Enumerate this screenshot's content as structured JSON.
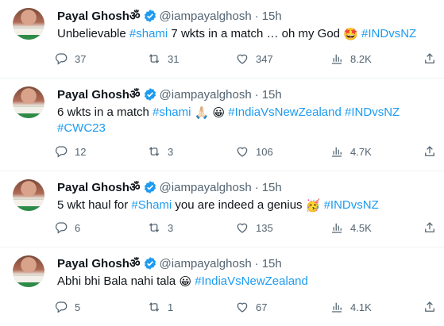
{
  "tweets": [
    {
      "name": "Payal Ghoshॐ",
      "handle": "@iampayalghosh",
      "dot": "·",
      "time": "15h",
      "text_parts": [
        "Unbelievable ",
        "#shami",
        " 7 wkts in a match … oh my God ",
        "🤩",
        " ",
        "#INDvsNZ"
      ],
      "replies": "37",
      "retweets": "31",
      "likes": "347",
      "views": "8.2K"
    },
    {
      "name": "Payal Ghoshॐ",
      "handle": "@iampayalghosh",
      "dot": "·",
      "time": "15h",
      "text_parts": [
        "6 wkts in a match  ",
        "#shami",
        " ",
        "🙏🏻",
        " ",
        "😀",
        " ",
        "#IndiaVsNewZealand",
        " ",
        "#INDvsNZ",
        " ",
        "#CWC23"
      ],
      "replies": "12",
      "retweets": "3",
      "likes": "106",
      "views": "4.7K"
    },
    {
      "name": "Payal Ghoshॐ",
      "handle": "@iampayalghosh",
      "dot": "·",
      "time": "15h",
      "text_parts": [
        "5 wkt haul for ",
        "#Shami",
        " you are indeed a genius ",
        "🥳",
        " ",
        "#INDvsNZ"
      ],
      "replies": "6",
      "retweets": "3",
      "likes": "135",
      "views": "4.5K"
    },
    {
      "name": "Payal Ghoshॐ",
      "handle": "@iampayalghosh",
      "dot": "·",
      "time": "15h",
      "text_parts": [
        "Abhi bhi Bala nahi tala ",
        "😀",
        " ",
        "#IndiaVsNewZealand"
      ],
      "replies": "5",
      "retweets": "1",
      "likes": "67",
      "views": "4.1K"
    }
  ],
  "icons": {
    "reply": "reply-icon",
    "retweet": "retweet-icon",
    "like": "heart-icon",
    "views": "views-icon",
    "share": "share-icon",
    "verified": "verified-badge-icon"
  },
  "colors": {
    "accent": "#1d9bf0",
    "muted": "#536471",
    "text": "#0f1419",
    "divider": "#eff3f4"
  }
}
